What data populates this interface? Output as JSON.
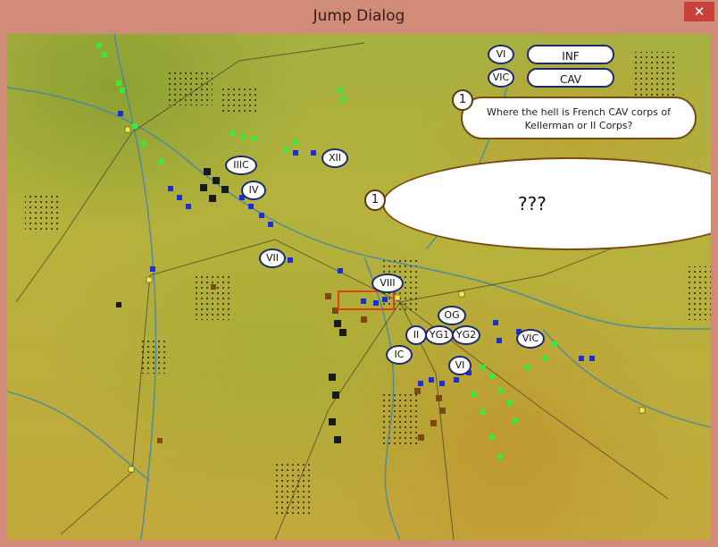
{
  "window": {
    "title": "Jump Dialog",
    "close_glyph": "✕"
  },
  "map": {
    "buttons": [
      {
        "tag": "VI",
        "label": "INF"
      },
      {
        "tag": "VIC",
        "label": "CAV"
      }
    ],
    "corps": [
      "IIIC",
      "IV",
      "XII",
      "VII",
      "VIII",
      "OG",
      "II",
      "YG1",
      "YG2",
      "IC",
      "VI",
      "VIC"
    ],
    "speech_small": {
      "badge": "1",
      "line1": "Where the hell is French CAV corps of",
      "line2": "Kellerman or II Corps?"
    },
    "speech_big": {
      "badge": "1",
      "text": "???"
    }
  }
}
